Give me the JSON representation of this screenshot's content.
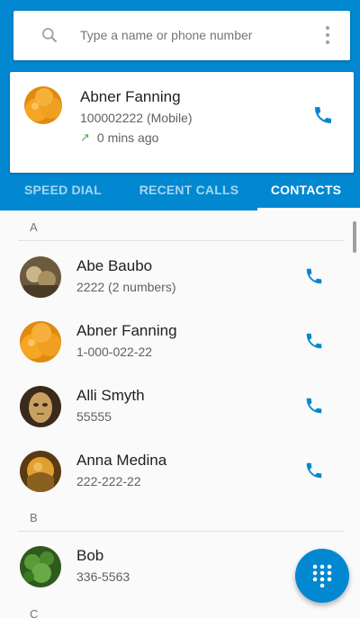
{
  "colors": {
    "accent": "#0288d1",
    "call_icon": "#0288d1"
  },
  "search": {
    "placeholder": "Type a name or phone number",
    "icon": "search-icon",
    "menu_icon": "more-vert-icon"
  },
  "recent_call": {
    "name": "Abner Fanning",
    "number": "100002222 (Mobile)",
    "time": "0 mins ago",
    "direction_icon": "outgoing-call-arrow-icon"
  },
  "tabs": [
    {
      "label": "SPEED DIAL"
    },
    {
      "label": "RECENT CALLS"
    },
    {
      "label": "CONTACTS"
    }
  ],
  "contacts": {
    "sections": [
      {
        "letter": "A"
      },
      {
        "letter": "B"
      },
      {
        "letter": "C"
      }
    ],
    "rows": [
      {
        "name": "Abe Baubo",
        "detail": "2222 (2 numbers)"
      },
      {
        "name": "Abner Fanning",
        "detail": "1-000-022-22"
      },
      {
        "name": "Alli Smyth",
        "detail": "55555"
      },
      {
        "name": "Anna Medina",
        "detail": "222-222-22"
      },
      {
        "name": "Bob",
        "detail": "336-5563"
      }
    ]
  },
  "fab": {
    "icon": "dialpad-icon"
  }
}
